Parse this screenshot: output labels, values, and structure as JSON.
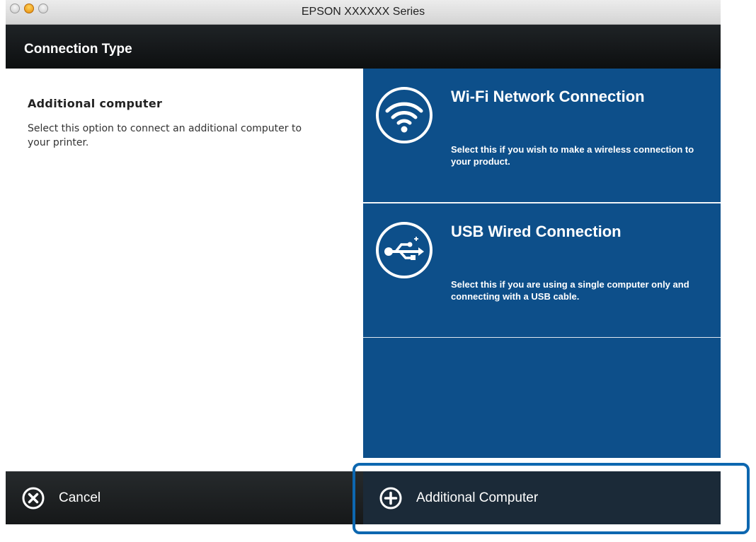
{
  "window": {
    "title": "EPSON XXXXXX Series"
  },
  "header": {
    "title": "Connection Type"
  },
  "left_pane": {
    "heading": "Additional computer",
    "description": "Select this option to connect an additional computer to your printer."
  },
  "options": [
    {
      "icon": "wifi-icon",
      "title": "Wi-Fi Network Connection",
      "description": "Select this if you wish to make a wireless connection to your product."
    },
    {
      "icon": "usb-icon",
      "title": "USB Wired Connection",
      "description": "Select this if you are using a single computer only and connecting with a USB cable."
    }
  ],
  "bottom": {
    "cancel_label": "Cancel",
    "additional_label": "Additional Computer"
  },
  "colors": {
    "option_blue": "#0d4f8a",
    "header_dark": "#1a1d1f",
    "highlight": "#0d67b0"
  }
}
